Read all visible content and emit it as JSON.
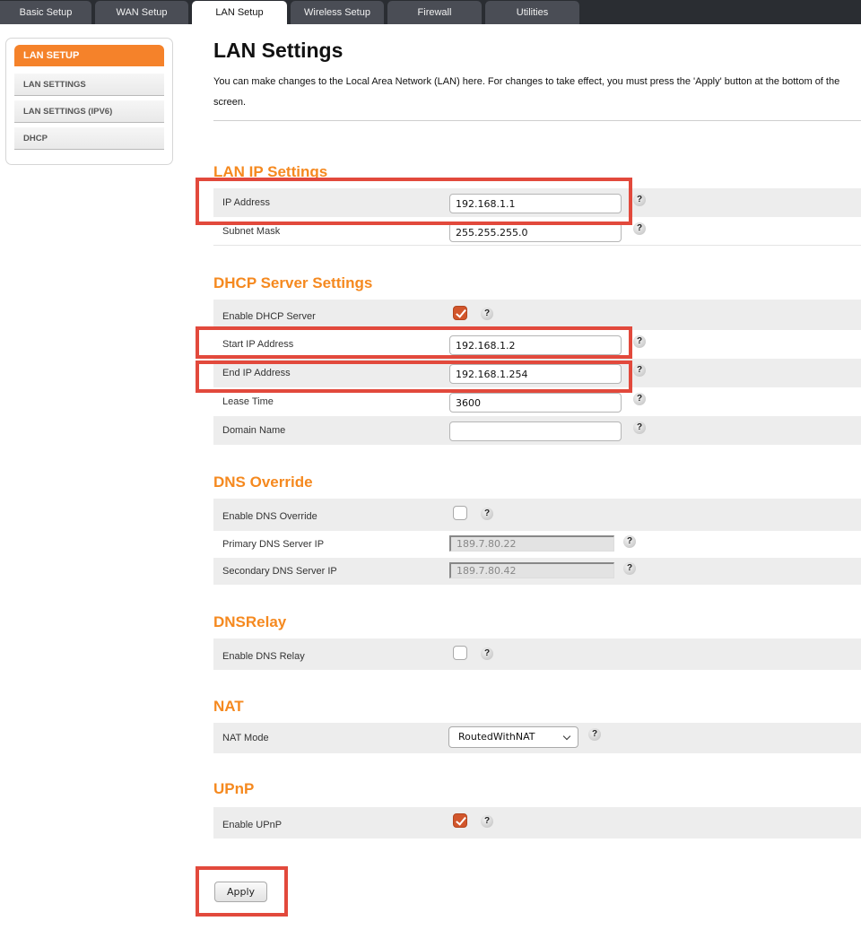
{
  "tabs": [
    {
      "label": "Basic Setup",
      "active": false
    },
    {
      "label": "WAN Setup",
      "active": false
    },
    {
      "label": "LAN Setup",
      "active": true
    },
    {
      "label": "Wireless Setup",
      "active": false
    },
    {
      "label": "Firewall",
      "active": false
    },
    {
      "label": "Utilities",
      "active": false
    }
  ],
  "sidebar": {
    "heading": "LAN SETUP",
    "items": [
      {
        "label": "LAN SETTINGS"
      },
      {
        "label": "LAN SETTINGS (IPV6)"
      },
      {
        "label": "DHCP"
      }
    ]
  },
  "page": {
    "title": "LAN Settings",
    "intro": "You can make changes to the Local Area Network (LAN) here. For changes to take effect, you must press the 'Apply' button at the bottom of the screen."
  },
  "lan_ip": {
    "title": "LAN IP Settings",
    "ip_address": {
      "label": "IP Address",
      "value": "192.168.1.1"
    },
    "subnet_mask": {
      "label": "Subnet Mask",
      "value": "255.255.255.0"
    }
  },
  "dhcp": {
    "title": "DHCP Server Settings",
    "enable": {
      "label": "Enable DHCP Server",
      "checked": true
    },
    "start_ip": {
      "label": "Start IP Address",
      "value": "192.168.1.2"
    },
    "end_ip": {
      "label": "End IP Address",
      "value": "192.168.1.254"
    },
    "lease_time": {
      "label": "Lease Time",
      "value": "3600"
    },
    "domain_name": {
      "label": "Domain Name",
      "value": ""
    }
  },
  "dns_override": {
    "title": "DNS Override",
    "enable": {
      "label": "Enable DNS Override",
      "checked": false
    },
    "primary": {
      "label": "Primary DNS Server IP",
      "value": "189.7.80.22"
    },
    "secondary": {
      "label": "Secondary DNS Server IP",
      "value": "189.7.80.42"
    }
  },
  "dns_relay": {
    "title": "DNSRelay",
    "enable": {
      "label": "Enable DNS Relay",
      "checked": false
    }
  },
  "nat": {
    "title": "NAT",
    "mode": {
      "label": "NAT Mode",
      "value": "RoutedWithNAT"
    }
  },
  "upnp": {
    "title": "UPnP",
    "enable": {
      "label": "Enable UPnP",
      "checked": true
    }
  },
  "help_glyph": "?",
  "apply_label": "Apply",
  "colors": {
    "accent": "#f5891f",
    "sidebar_active": "#f5822a",
    "checkbox_checked": "#d2562c",
    "highlight": "#e2493c",
    "tabbar": "#2a2d32"
  }
}
